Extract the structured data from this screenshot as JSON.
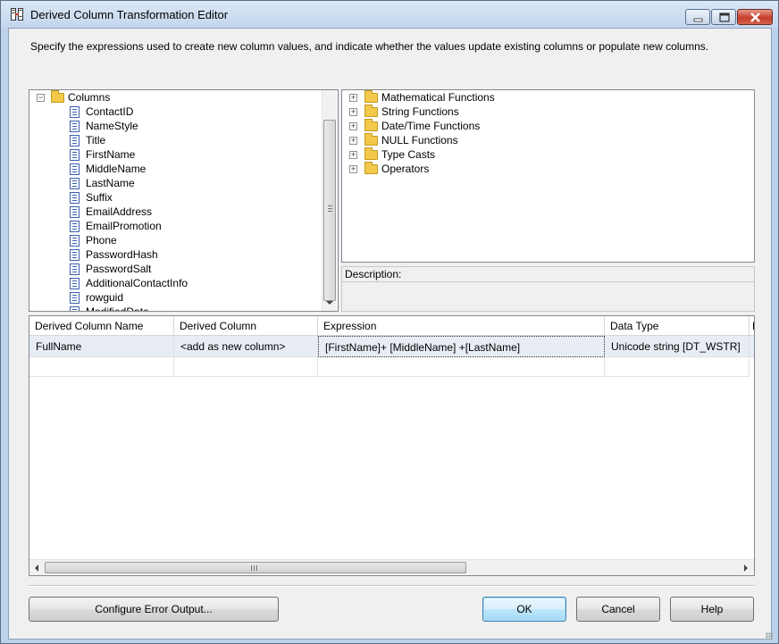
{
  "window": {
    "title": "Derived Column Transformation Editor"
  },
  "instructions": "Specify the expressions used to create new column values, and indicate whether the values update existing columns or populate new columns.",
  "columns_tree": {
    "root_label": "Columns",
    "items": [
      "ContactID",
      "NameStyle",
      "Title",
      "FirstName",
      "MiddleName",
      "LastName",
      "Suffix",
      "EmailAddress",
      "EmailPromotion",
      "Phone",
      "PasswordHash",
      "PasswordSalt",
      "AdditionalContactInfo",
      "rowguid",
      "ModifiedDate"
    ]
  },
  "functions_tree": {
    "items": [
      "Mathematical Functions",
      "String Functions",
      "Date/Time Functions",
      "NULL Functions",
      "Type Casts",
      "Operators"
    ]
  },
  "description": {
    "label": "Description:"
  },
  "grid": {
    "headers": [
      "Derived Column Name",
      "Derived Column",
      "Expression",
      "Data Type",
      "L"
    ],
    "rows": [
      {
        "name": "FullName",
        "derived_column": "<add as new column>",
        "expression": "[FirstName]+ [MiddleName] +[LastName]",
        "data_type": "Unicode string [DT_WSTR]"
      }
    ]
  },
  "buttons": {
    "configure_error": "Configure Error Output...",
    "ok": "OK",
    "cancel": "Cancel",
    "help": "Help"
  },
  "icons": {
    "title": "derived-column-icon",
    "minimize": "minimize-icon",
    "maximize": "maximize-icon",
    "close": "close-icon",
    "folder": "folder-icon",
    "column": "column-icon"
  }
}
